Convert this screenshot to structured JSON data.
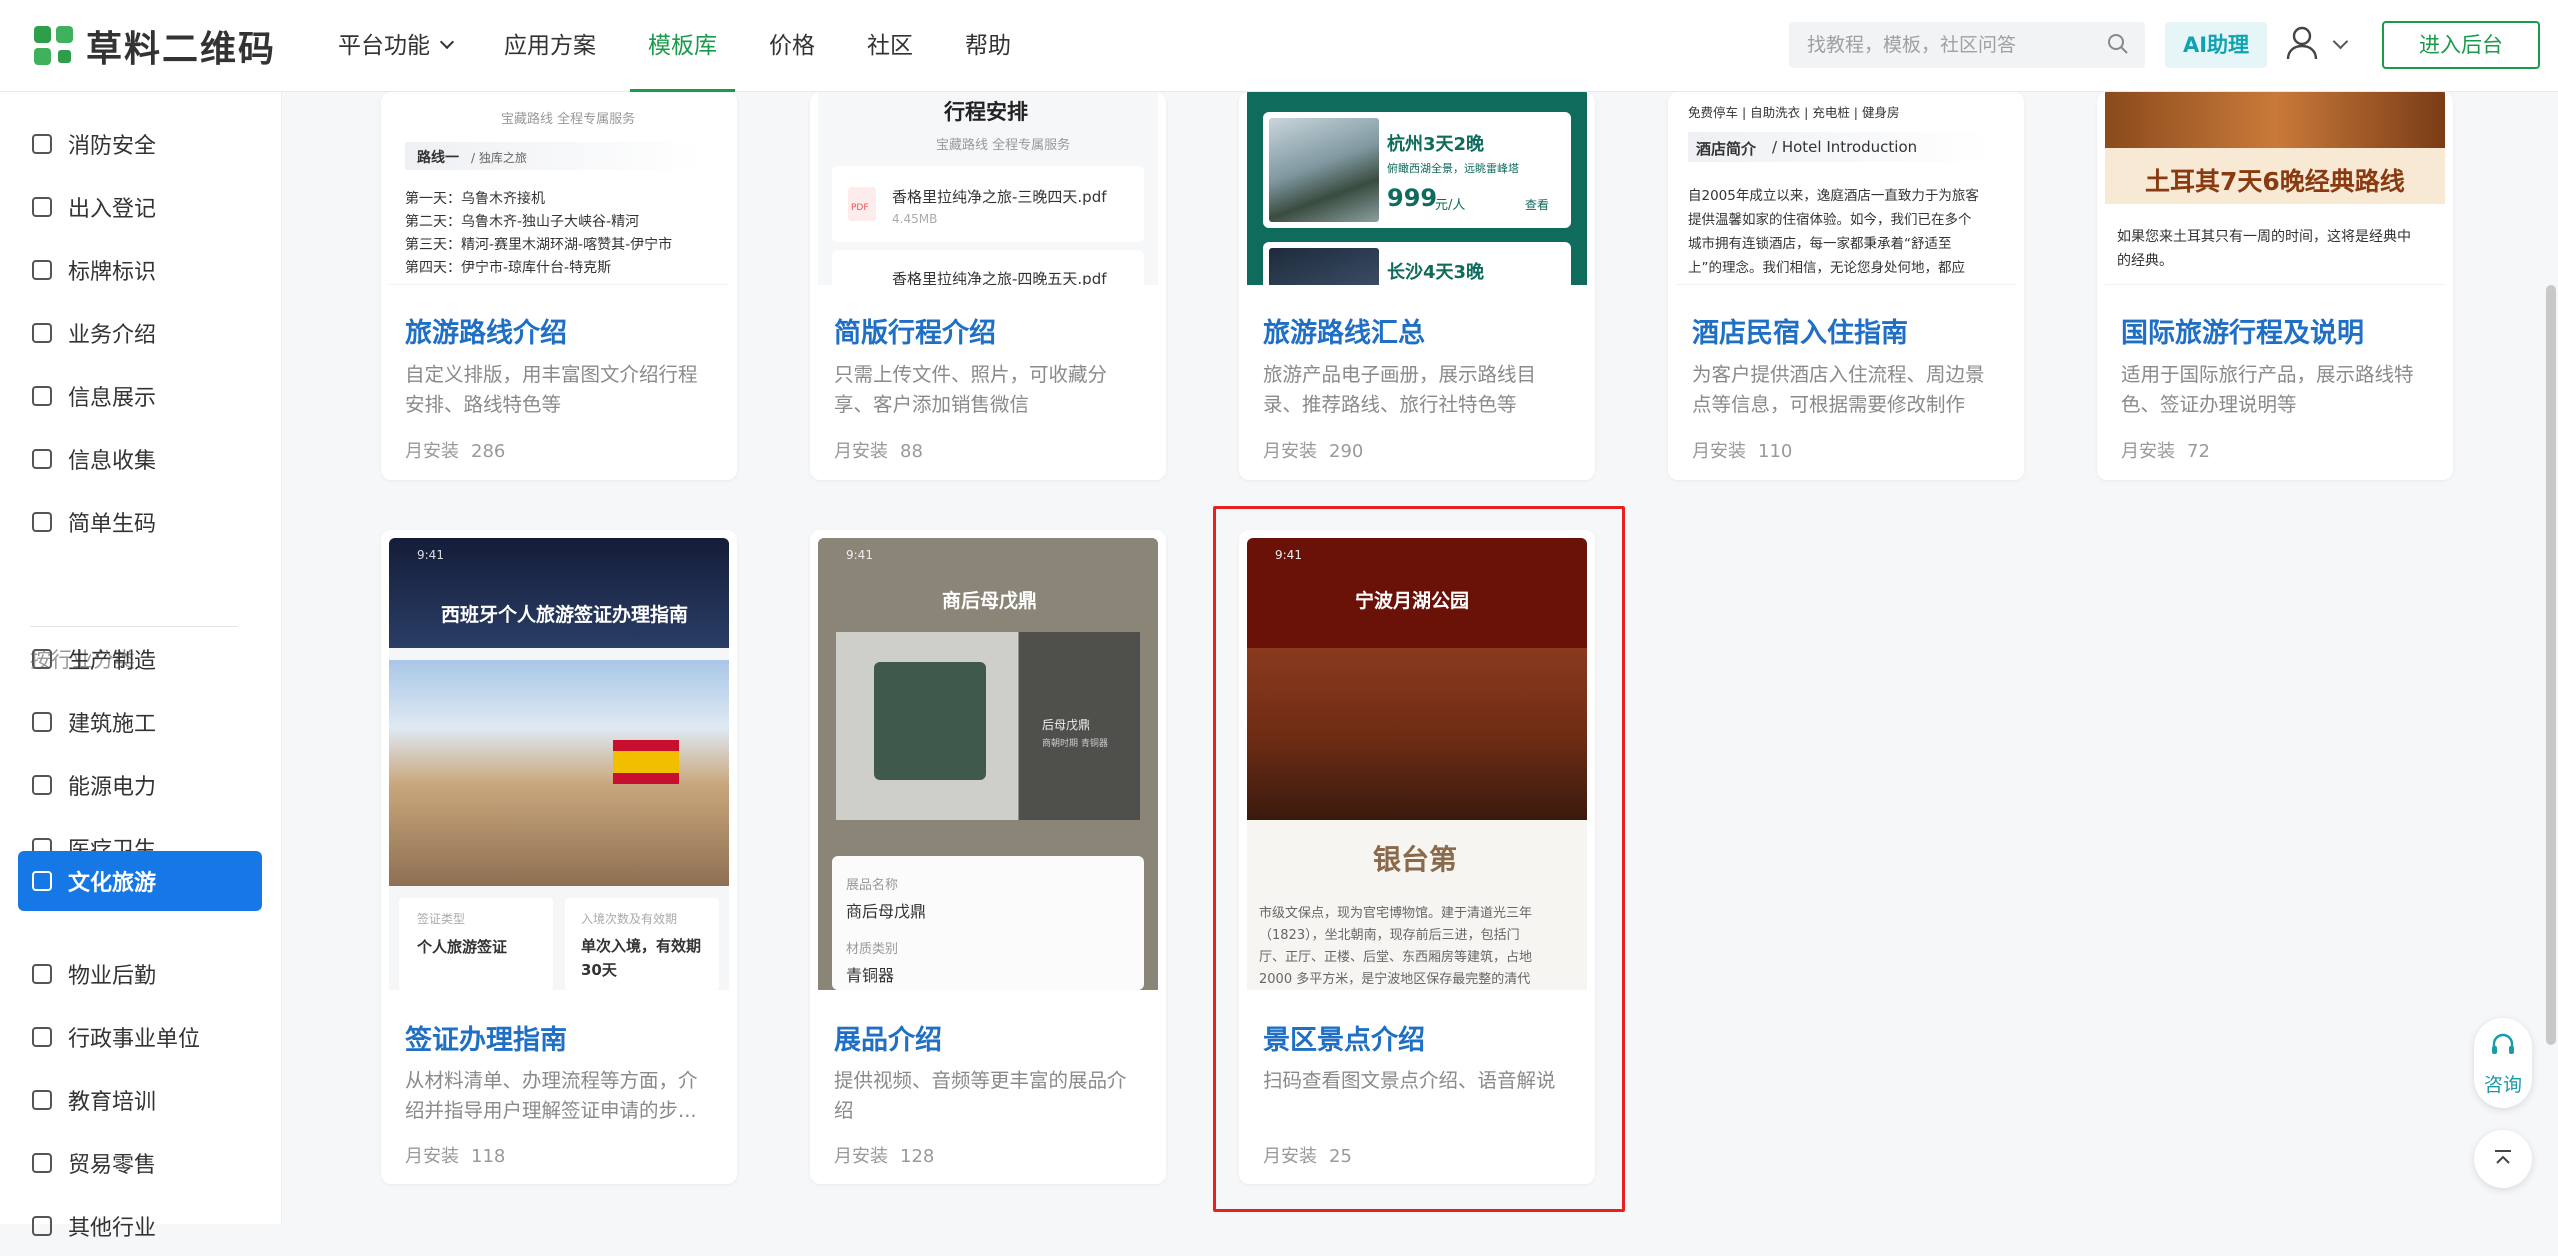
{
  "header": {
    "logo": "草料二维码",
    "nav": [
      "平台功能",
      "应用方案",
      "模板库",
      "价格",
      "社区",
      "帮助"
    ],
    "search_placeholder": "找教程，模板，社区问答",
    "ai_label": "AI助理",
    "enter_label": "进入后台"
  },
  "sidebar": {
    "items_top": [
      "消防安全",
      "出入登记",
      "标牌标识",
      "业务介绍",
      "信息展示",
      "信息收集",
      "简单生码"
    ],
    "group_label": "按行业分类",
    "items_industry": [
      "生产制造",
      "建筑施工",
      "能源电力",
      "医疗卫生",
      "文化旅游",
      "物业后勤",
      "行政事业单位",
      "教育培训",
      "贸易零售",
      "其他行业"
    ],
    "active": "文化旅游"
  },
  "stat_label": "月安装",
  "cards": [
    {
      "title": "旅游路线介绍",
      "desc": "自定义排版，用丰富图文介绍行程安排、路线特色等",
      "installs": "286",
      "thumb": {
        "sub": "宝藏路线 全程专属服务",
        "chip": "路线一",
        "chip2": "/ 独库之旅",
        "lines": [
          "第一天：乌鲁木齐接机",
          "第二天：乌鲁木齐-独山子大峡谷-精河",
          "第三天：精河-赛里木湖环湖-喀赞其-伊宁市",
          "第四天：伊宁市-琼库什台-特克斯"
        ]
      }
    },
    {
      "title": "简版行程介绍",
      "desc": "只需上传文件、照片，可收藏分享、客户添加销售微信",
      "installs": "88",
      "thumb": {
        "heading": "行程安排",
        "sub": "宝藏路线 全程专属服务",
        "file1": "香格里拉纯净之旅-三晚四天.pdf",
        "size1": "4.45MB",
        "file2": "香格里拉纯净之旅-四晚五天.pdf",
        "pdf": "PDF"
      }
    },
    {
      "title": "旅游路线汇总",
      "desc": "旅游产品电子画册，展示路线目录、推荐路线、旅行社特色等",
      "installs": "290",
      "thumb": {
        "route1": "杭州3天2晚",
        "route1_sub": "俯瞰西湖全景，远眺雷峰塔",
        "price": "999",
        "unit": "元/人",
        "more": "查看",
        "route2": "长沙4天3晚"
      }
    },
    {
      "title": "酒店民宿入住指南",
      "desc": "为客户提供酒店入住流程、周边景点等信息，可根据需要修改制作",
      "installs": "110",
      "thumb": {
        "amenities": "免费停车 | 自助洗衣 | 充电桩 | 健身房",
        "tab": "酒店简介",
        "tab2": "/ Hotel Introduction",
        "lines": [
          "自2005年成立以来，逸庭酒店一直致力于为旅客",
          "提供温馨如家的住宿体验。如今，我们已在多个",
          "城市拥有连锁酒店，每一家都秉承着“舒适至",
          "上”的理念。我们相信，无论您身处何地，都应"
        ]
      }
    },
    {
      "title": "国际旅游行程及说明",
      "desc": "适用于国际旅行产品，展示路线特色、签证办理说明等",
      "installs": "72",
      "thumb": {
        "banner": "土耳其7天6晚经典路线",
        "lines": [
          "如果您来土耳其只有一周的时间，这将是经典中",
          "的经典。"
        ]
      }
    },
    {
      "title": "签证办理指南",
      "desc": "从材料清单、办理流程等方面，介绍并指导用户理解签证申请的步...",
      "installs": "118",
      "thumb": {
        "time": "9:41",
        "banner": "西班牙个人旅游签证办理指南",
        "k1": "签证类型",
        "v1": "个人旅游签证",
        "k2": "入境次数及有效期",
        "v2": "单次入境，有效期30天"
      }
    },
    {
      "title": "展品介绍",
      "desc": "提供视频、音频等更丰富的展品介绍",
      "installs": "128",
      "thumb": {
        "time": "9:41",
        "heading": "商后母戊鼎",
        "side_title": "后母戊鼎",
        "side_sub": "商朝时期 青铜器",
        "k1": "展品名称",
        "v1": "商后母戊鼎",
        "k2": "材质类别",
        "v2": "青铜器"
      }
    },
    {
      "title": "景区景点介绍",
      "desc": "扫码查看图文景点介绍、语音解说",
      "installs": "25",
      "thumb": {
        "time": "9:41",
        "heading": "宁波月湖公园",
        "name": "银台第",
        "lines": [
          "市级文保点，现为官宅博物馆。建于清道光三年",
          "（1823），坐北朝南，现存前后三进，包括门",
          "厅、正厅、正楼、后堂、东西厢房等建筑，占地",
          "2000 多平方米，是宁波地区保存最完整的清代"
        ]
      }
    }
  ],
  "float": {
    "consult": "咨询"
  },
  "colors": {
    "brand": "#1a9b4b",
    "title_blue": "#1f6fc5",
    "active_bg": "#1677e6",
    "highlight": "#e82020"
  }
}
